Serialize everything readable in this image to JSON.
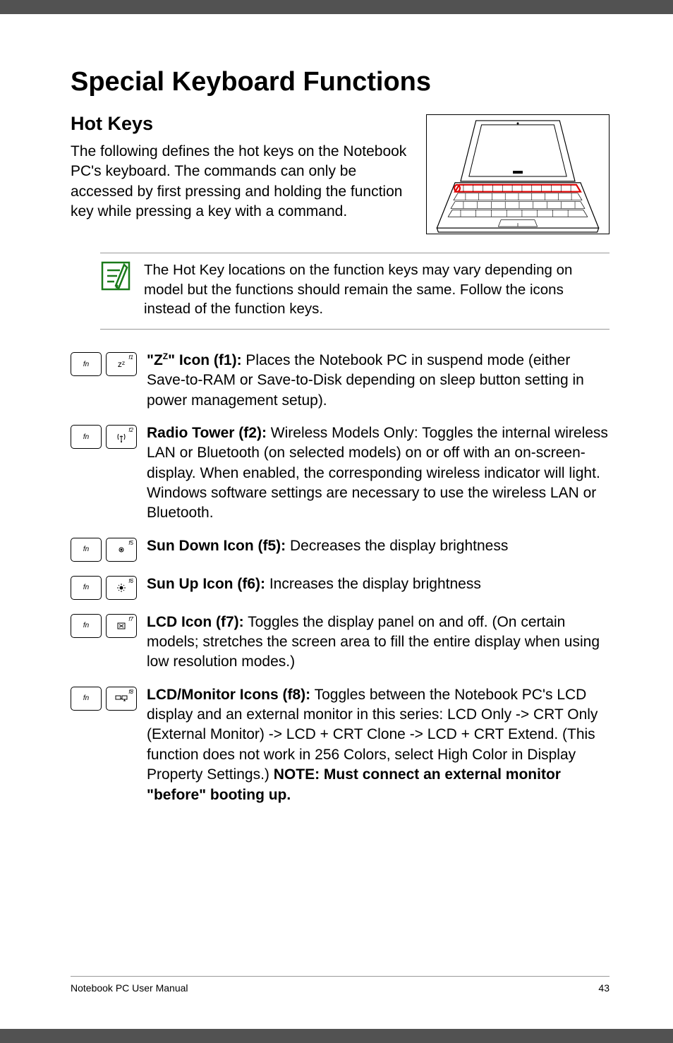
{
  "heading": "Special Keyboard Functions",
  "subheading": "Hot Keys",
  "intro": "The following defines the hot keys on the Notebook PC's keyboard. The commands can only be accessed by first pressing and holding the function key while pressing a key with a command.",
  "note": "The Hot Key locations on the function keys may vary depending on model but the functions should remain the same. Follow the icons instead of the function keys.",
  "entries": {
    "zz": {
      "lead_pre": "\"Z",
      "lead_sup": "Z",
      "lead_post": "\" Icon (f1):",
      "body": " Places the Notebook PC in suspend mode (either Save-to-RAM or Save-to-Disk depending on sleep button setting in power management setup)."
    },
    "radio": {
      "lead": "Radio Tower (f2):",
      "body": " Wireless Models Only: Toggles the internal wireless LAN or Bluetooth (on selected models) on or off with an on-screen-display. When enabled, the corresponding wireless indicator will light. Windows software settings are necessary to use the wireless LAN or Bluetooth."
    },
    "sundown": {
      "lead": "Sun Down Icon (f5):",
      "body": " Decreases the display brightness"
    },
    "sunup": {
      "lead": "Sun Up Icon (f6):",
      "body": " Increases the display brightness"
    },
    "lcd": {
      "lead": "LCD Icon (f7):",
      "body": " Toggles the display panel on and off. (On certain models; stretches the screen area to fill the entire display when using low resolution modes.)"
    },
    "lcdmon": {
      "lead": "LCD/Monitor Icons (f8):",
      "body": " Toggles between the Notebook PC's LCD display and an external monitor in this series: LCD Only -> CRT Only (External Monitor) -> LCD + CRT Clone -> LCD + CRT Extend. (This function does not work in 256 Colors, select High Color in Display Property Settings.) ",
      "bold_tail": "NOTE: Must connect an external monitor \"before\" booting up."
    }
  },
  "keys": {
    "fn": "fn",
    "f1": "f1",
    "f2": "f2",
    "f5": "f5",
    "f6": "f6",
    "f7": "f7",
    "f8": "f8",
    "zz_glyph": "zᶻ"
  },
  "footer": {
    "left": "Notebook PC User Manual",
    "right": "43"
  }
}
